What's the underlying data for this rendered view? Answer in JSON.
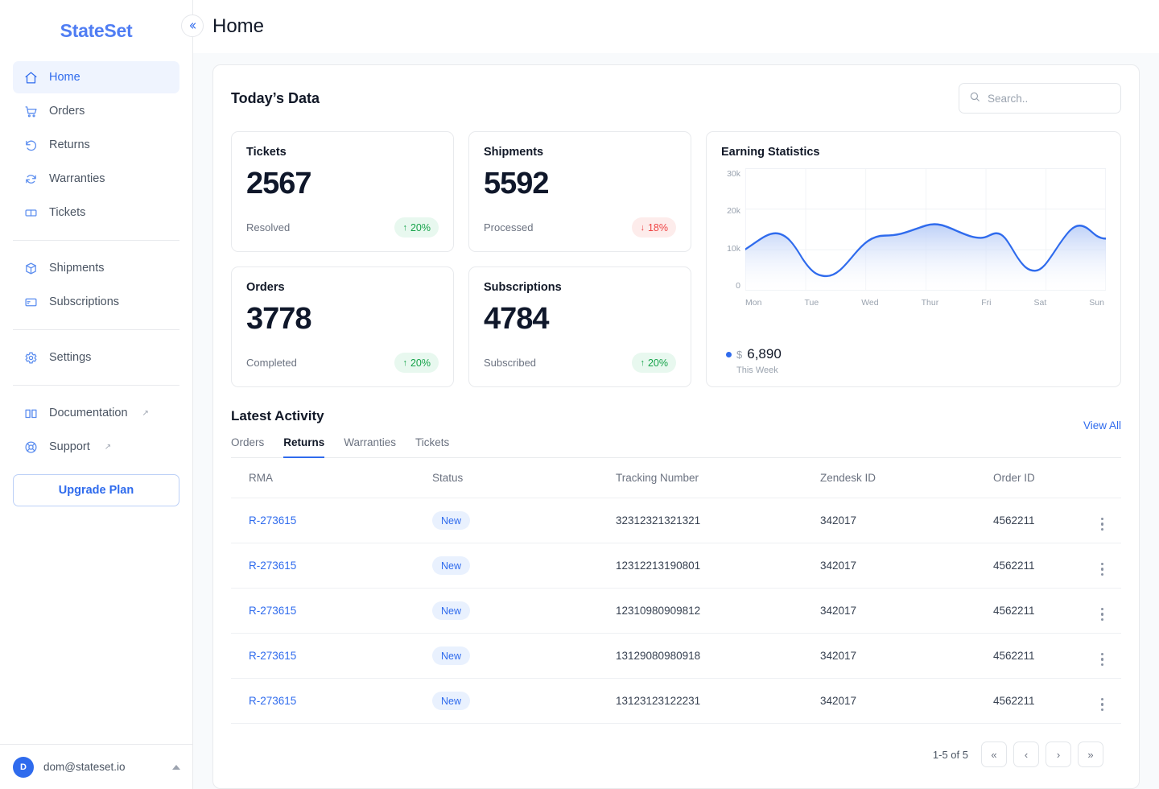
{
  "brand": {
    "name": "StateSet"
  },
  "header": {
    "title": "Home",
    "collapse_icon": "chevrons-left-icon"
  },
  "sidebar": {
    "groups": [
      {
        "items": [
          {
            "label": "Home",
            "icon": "home-icon",
            "active": true
          },
          {
            "label": "Orders",
            "icon": "cart-icon",
            "active": false
          },
          {
            "label": "Returns",
            "icon": "return-arrow-icon",
            "active": false
          },
          {
            "label": "Warranties",
            "icon": "refresh-icon",
            "active": false
          },
          {
            "label": "Tickets",
            "icon": "ticket-icon",
            "active": false
          }
        ]
      },
      {
        "items": [
          {
            "label": "Shipments",
            "icon": "box-icon",
            "active": false
          },
          {
            "label": "Subscriptions",
            "icon": "card-icon",
            "active": false
          }
        ]
      },
      {
        "items": [
          {
            "label": "Settings",
            "icon": "gear-icon",
            "active": false
          }
        ]
      },
      {
        "items": [
          {
            "label": "Documentation",
            "icon": "book-icon",
            "external": "↗",
            "active": false
          },
          {
            "label": "Support",
            "icon": "lifebuoy-icon",
            "external": "↗",
            "active": false
          }
        ]
      }
    ],
    "upgrade_label": "Upgrade Plan",
    "user": {
      "initial": "D",
      "email": "dom@stateset.io",
      "caret": "chevron-up-icon"
    }
  },
  "today": {
    "title": "Today’s Data",
    "search_placeholder": "Search..",
    "search_value": "",
    "search_icon": "search-icon",
    "cards": [
      {
        "label": "Tickets",
        "value": "2567",
        "sub": "Resolved",
        "trend": "20%",
        "dir": "up",
        "arrow": "↑"
      },
      {
        "label": "Shipments",
        "value": "5592",
        "sub": "Processed",
        "trend": "18%",
        "dir": "down",
        "arrow": "↓"
      },
      {
        "label": "Orders",
        "value": "3778",
        "sub": "Completed",
        "trend": "20%",
        "dir": "up",
        "arrow": "↑"
      },
      {
        "label": "Subscriptions",
        "value": "4784",
        "sub": "Subscribed",
        "trend": "20%",
        "dir": "up",
        "arrow": "↑"
      }
    ]
  },
  "chart_data": {
    "type": "area",
    "title": "Earning Statistics",
    "xlabel": "",
    "ylabel": "",
    "ylim": [
      0,
      30000
    ],
    "yticks": [
      "30k",
      "20k",
      "10k",
      "0"
    ],
    "categories": [
      "Mon",
      "Tue",
      "Wed",
      "Thur",
      "Fri",
      "Sat",
      "Sun"
    ],
    "x": [
      0,
      0.5,
      1,
      1.5,
      2,
      2.5,
      3,
      3.5,
      4,
      4.3,
      4.6,
      5,
      5.5,
      6
    ],
    "values": [
      10200,
      14000,
      6200,
      9000,
      13500,
      15000,
      16400,
      14000,
      12800,
      13800,
      10500,
      7200,
      19000,
      16200
    ],
    "series": [
      {
        "name": "This Week",
        "values": [
          10200,
          14000,
          6200,
          9000,
          13500,
          15000,
          16400,
          14000,
          12800,
          13800,
          10500,
          7200,
          19000,
          16200
        ]
      }
    ],
    "grid": true,
    "legend_position": "bottom-left",
    "line_color": "#2f6bed",
    "fill_from": "#b9cdf7",
    "fill_to": "#ffffff",
    "footer": {
      "currency": "$",
      "total": "6,890",
      "period": "This Week",
      "dot": "legend-dot-icon"
    }
  },
  "activity": {
    "title": "Latest Activity",
    "view_all": "View All",
    "tabs": [
      {
        "label": "Orders",
        "active": false
      },
      {
        "label": "Returns",
        "active": true
      },
      {
        "label": "Warranties",
        "active": false
      },
      {
        "label": "Tickets",
        "active": false
      }
    ],
    "columns": [
      "RMA",
      "Status",
      "Tracking Number",
      "Zendesk ID",
      "Order ID"
    ],
    "rows": [
      {
        "rma": "R-273615",
        "status": "New",
        "tracking": "32312321321321",
        "zendesk": "342017",
        "order": "4562211",
        "menu": "kebab-menu-icon"
      },
      {
        "rma": "R-273615",
        "status": "New",
        "tracking": "12312213190801",
        "zendesk": "342017",
        "order": "4562211",
        "menu": "kebab-menu-icon"
      },
      {
        "rma": "R-273615",
        "status": "New",
        "tracking": "12310980909812",
        "zendesk": "342017",
        "order": "4562211",
        "menu": "kebab-menu-icon"
      },
      {
        "rma": "R-273615",
        "status": "New",
        "tracking": "13129080980918",
        "zendesk": "342017",
        "order": "4562211",
        "menu": "kebab-menu-icon"
      },
      {
        "rma": "R-273615",
        "status": "New",
        "tracking": "13123123122231",
        "zendesk": "342017",
        "order": "4562211",
        "menu": "kebab-menu-icon"
      }
    ],
    "pagination": {
      "range": "1-5 of 5",
      "first": "«",
      "prev": "‹",
      "next": "›",
      "last": "»"
    }
  }
}
